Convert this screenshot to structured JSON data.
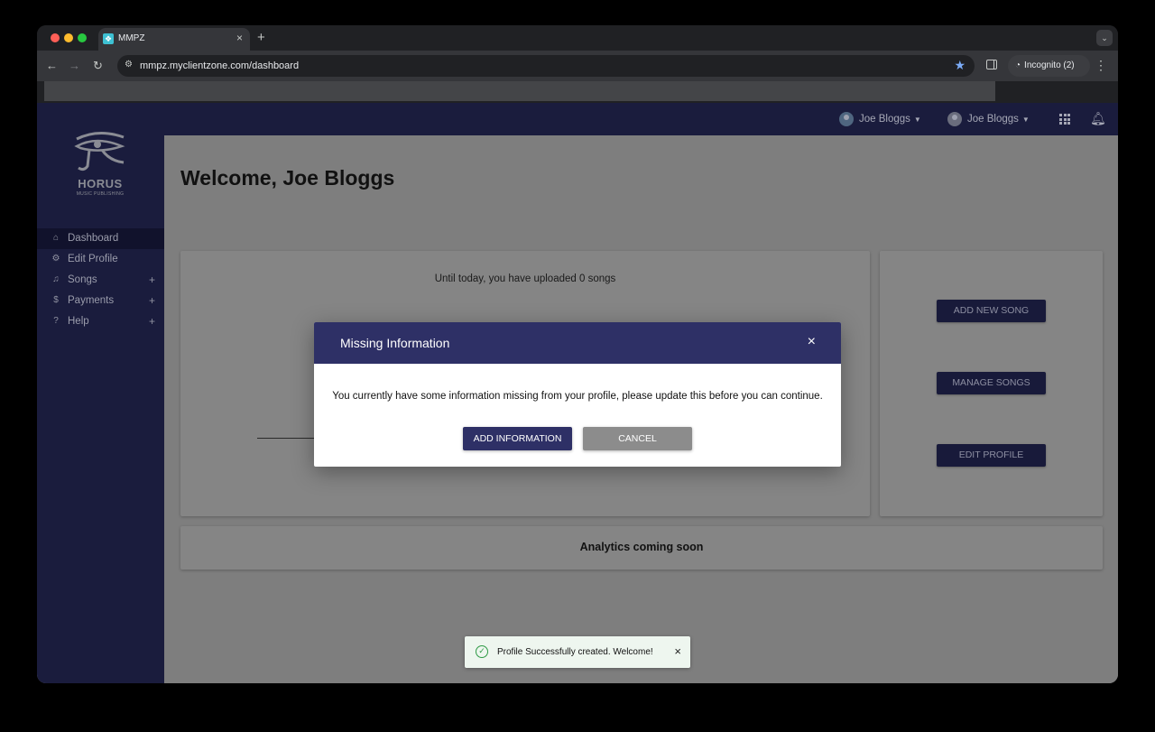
{
  "browser": {
    "tab_title": "MMPZ",
    "url": "mmpz.myclientzone.com/dashboard",
    "incognito_label": "Incognito (2)",
    "new_tab": "+",
    "tab_close": "×",
    "menu": "⋮"
  },
  "sidebar": {
    "logo_text": "HORUS",
    "logo_sub": "MUSIC PUBLISHING",
    "items": [
      {
        "label": "Dashboard",
        "icon": "home-icon",
        "glyph": "⌂",
        "active": true
      },
      {
        "label": "Edit Profile",
        "icon": "user-gear-icon",
        "glyph": "⚙",
        "expand": ""
      },
      {
        "label": "Songs",
        "icon": "music-library-icon",
        "glyph": "♫",
        "expand": "+"
      },
      {
        "label": "Payments",
        "icon": "dollar-icon",
        "glyph": "$",
        "expand": "+"
      },
      {
        "label": "Help",
        "icon": "question-icon",
        "glyph": "?",
        "expand": "+"
      }
    ]
  },
  "topbar": {
    "user1": "Joe Bloggs",
    "user2": "Joe Bloggs"
  },
  "main": {
    "welcome": "Welcome, Joe Bloggs",
    "uploaded_text": "Until today, you have uploaded 0 songs",
    "buttons": {
      "add_new_song": "ADD NEW SONG",
      "manage_songs": "MANAGE SONGS",
      "edit_profile": "EDIT PROFILE"
    },
    "analytics": "Analytics coming soon"
  },
  "modal": {
    "title": "Missing Information",
    "body": "You currently have some information missing from your profile, please update this before you can continue.",
    "add_button": "ADD INFORMATION",
    "cancel_button": "CANCEL",
    "close": "×"
  },
  "toast": {
    "text": "Profile Successfully created. Welcome!",
    "close": "×"
  },
  "colors": {
    "nav_bg": "#1a1c3d",
    "accent": "#2e3066",
    "success": "#2e9a45"
  }
}
